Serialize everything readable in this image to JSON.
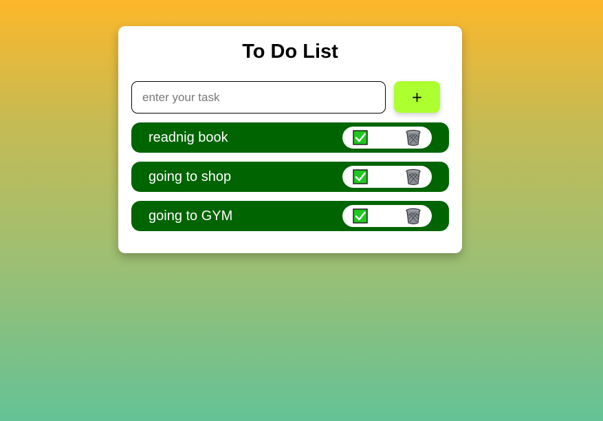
{
  "app": {
    "title": "To Do List"
  },
  "input": {
    "value": "",
    "placeholder": "enter your task"
  },
  "add_button": {
    "label": "+",
    "color": "#adff2f"
  },
  "tasks": [
    {
      "text": "readnig book",
      "done_icon": "check-icon",
      "delete_icon": "trash-icon"
    },
    {
      "text": "going to shop",
      "done_icon": "check-icon",
      "delete_icon": "trash-icon"
    },
    {
      "text": "going to GYM",
      "done_icon": "check-icon",
      "delete_icon": "trash-icon"
    }
  ],
  "colors": {
    "task_background": "#006400",
    "check_green": "#1ec81e",
    "card_background": "#ffffff"
  }
}
